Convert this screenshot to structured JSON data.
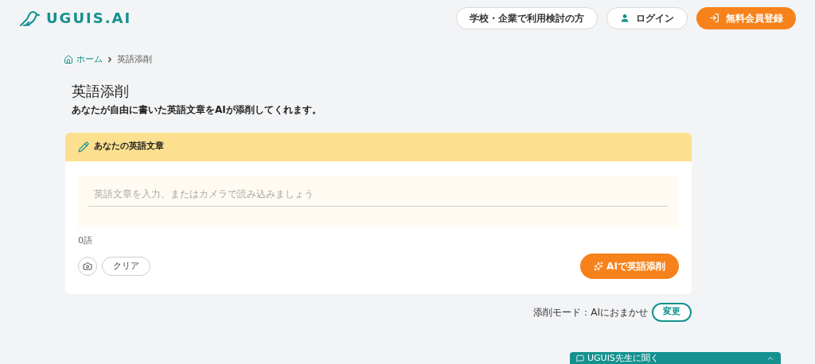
{
  "header": {
    "logo": "UGUIS.AI",
    "buttons": [
      {
        "kind": "outline",
        "label": "学校・企業で利用検討の方"
      },
      {
        "kind": "login",
        "label": "ログイン"
      },
      {
        "kind": "primary",
        "label": "無料会員登録"
      }
    ]
  },
  "breadcrumb": [
    {
      "label": "ホーム"
    },
    {
      "label": "英語添削"
    }
  ],
  "title": "英語添削",
  "subtitle": "あなたが自由に書いた英語文章をAIが添削してくれます。",
  "editor": {
    "heading": "あなたの英語文章",
    "placeholder": "英語文章を入力、またはカメラで読み込みましょう",
    "word_count": "0語",
    "clear": "クリア",
    "submit": "AIで英語添削"
  },
  "mode": {
    "label": "添削モード：AIにおまかせ",
    "change": "変更"
  },
  "chat_bar": {
    "label": "UGUIS先生に聞く"
  }
}
